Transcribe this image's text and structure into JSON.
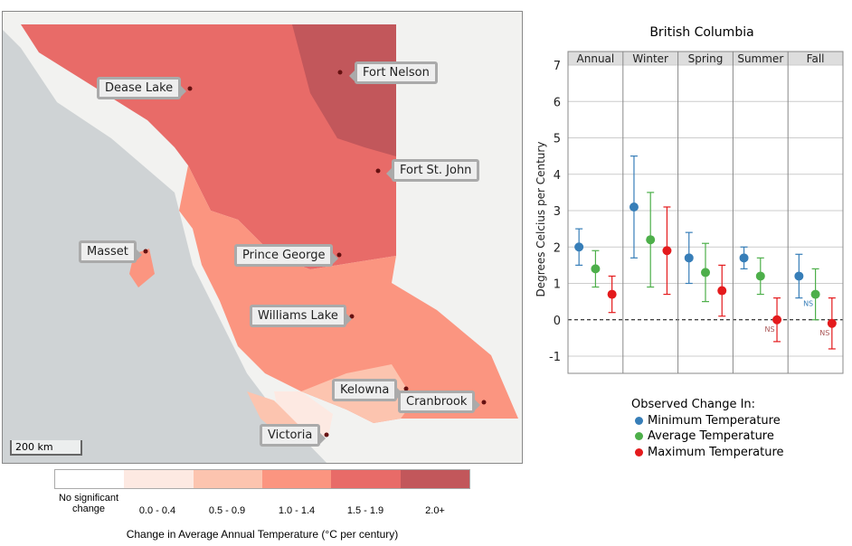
{
  "map": {
    "scale_label": "200 km",
    "cities": [
      "Dease Lake",
      "Fort Nelson",
      "Fort St. John",
      "Masset",
      "Prince George",
      "Williams Lake",
      "Kelowna",
      "Cranbrook",
      "Victoria"
    ]
  },
  "legend": {
    "title": "Change in Average Annual Temperature (°C per century)",
    "bins": [
      {
        "label": "No significant change",
        "color": "#ffffff"
      },
      {
        "label": "0.0 - 0.4",
        "color": "#fde9e2"
      },
      {
        "label": "0.5 - 0.9",
        "color": "#fcc4af"
      },
      {
        "label": "1.0 - 1.4",
        "color": "#fb9580"
      },
      {
        "label": "1.5 - 1.9",
        "color": "#e86b68"
      },
      {
        "label": "2.0+",
        "color": "#c2575b"
      }
    ]
  },
  "chart_data": {
    "type": "scatter",
    "title": "British Columbia",
    "ylabel": "Degrees Celcius per Century",
    "ylim": [
      -1.5,
      7
    ],
    "yticks": [
      -1,
      0,
      1,
      2,
      3,
      4,
      5,
      6,
      7
    ],
    "grid": true,
    "categories": [
      "Annual",
      "Winter",
      "Spring",
      "Summer",
      "Fall"
    ],
    "legend_title": "Observed Change In:",
    "legend_position": "bottom",
    "series": [
      {
        "name": "Minimum Temperature",
        "color": "#377eb8",
        "values": [
          2.0,
          3.1,
          1.7,
          1.7,
          1.2
        ],
        "low": [
          1.5,
          1.7,
          1.0,
          1.4,
          0.6
        ],
        "high": [
          2.5,
          4.5,
          2.4,
          2.0,
          1.8
        ],
        "ns": [
          false,
          false,
          false,
          false,
          false
        ]
      },
      {
        "name": "Average Temperature",
        "color": "#4daf4a",
        "values": [
          1.4,
          2.2,
          1.3,
          1.2,
          0.7
        ],
        "low": [
          0.9,
          0.9,
          0.5,
          0.7,
          0.0
        ],
        "high": [
          1.9,
          3.5,
          2.1,
          1.7,
          1.4
        ],
        "ns": [
          false,
          false,
          false,
          false,
          true
        ]
      },
      {
        "name": "Maximum Temperature",
        "color": "#e41a1c",
        "values": [
          0.7,
          1.9,
          0.8,
          0.0,
          -0.1
        ],
        "low": [
          0.2,
          0.7,
          0.1,
          -0.6,
          -0.8
        ],
        "high": [
          1.2,
          3.1,
          1.5,
          0.6,
          0.6
        ],
        "ns": [
          false,
          false,
          false,
          true,
          true
        ]
      }
    ],
    "ns_label": "NS"
  }
}
